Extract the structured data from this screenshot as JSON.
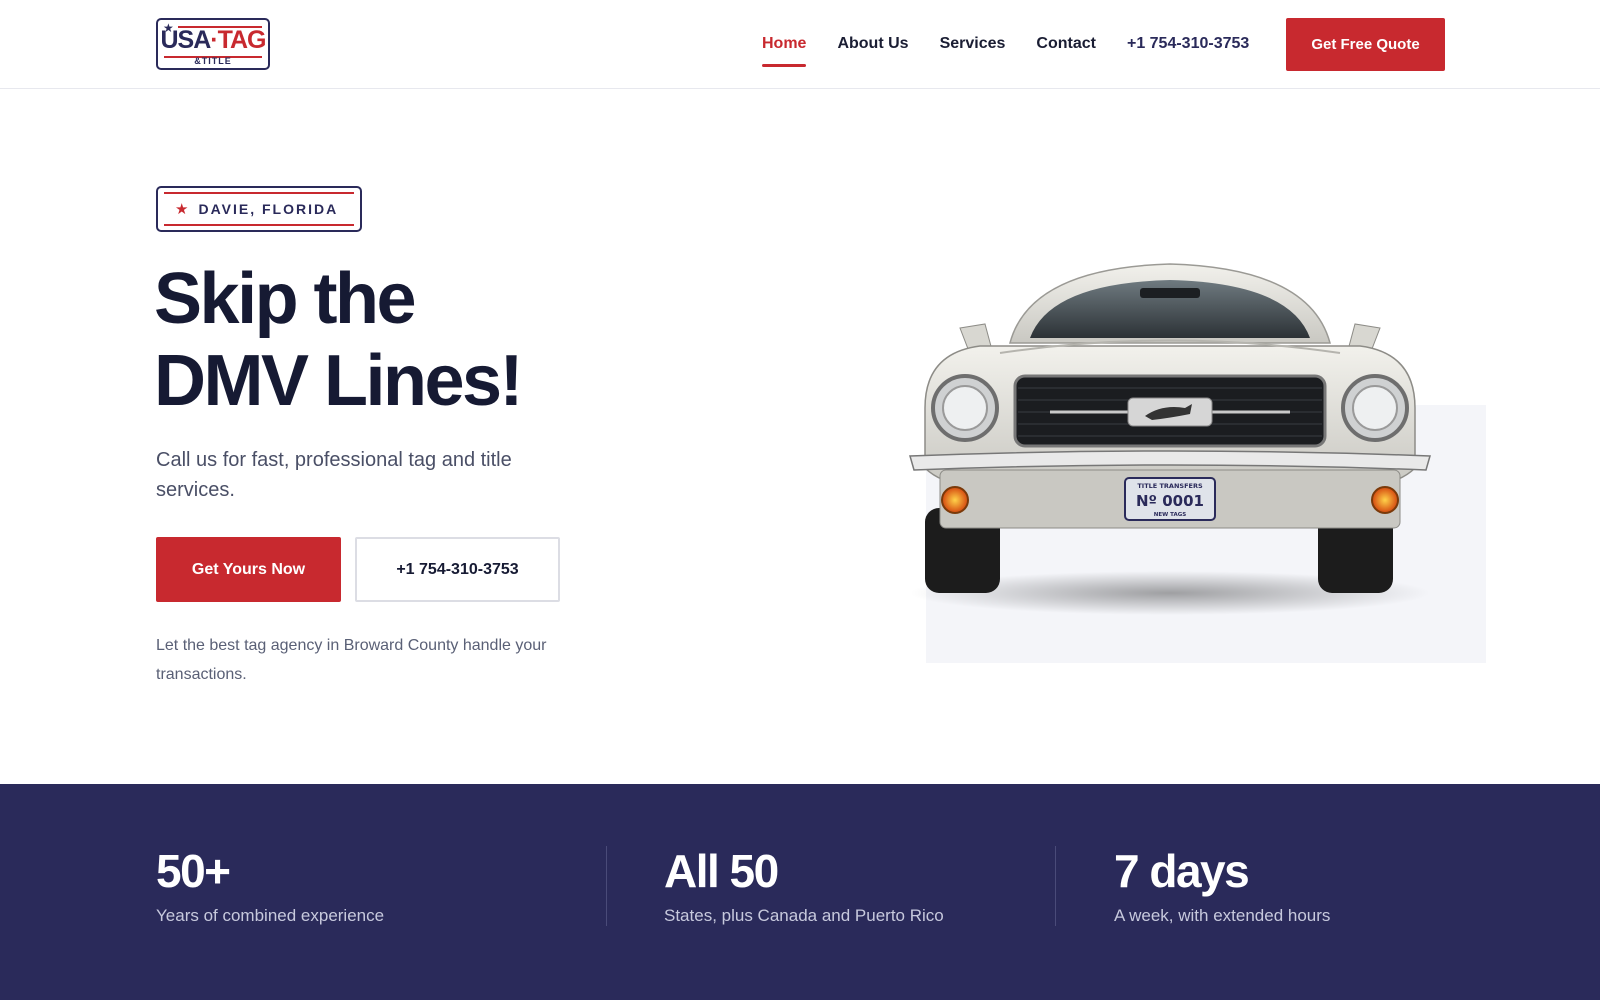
{
  "header": {
    "logo": {
      "line1_a": "USA",
      "line1_b": "·TAG",
      "line2": "&TITLE"
    },
    "nav": [
      {
        "label": "Home",
        "active": true
      },
      {
        "label": "About Us",
        "active": false
      },
      {
        "label": "Services",
        "active": false
      },
      {
        "label": "Contact",
        "active": false
      }
    ],
    "phone": "+1 754-310-3753",
    "cta": "Get Free Quote"
  },
  "hero": {
    "badge": "DAVIE, FLORIDA",
    "badge_icon": "star-icon",
    "title_line1": "Skip the",
    "title_line2": "DMV Lines!",
    "subtitle": "Call us for fast, professional tag and title services.",
    "primary_button": "Get Yours Now",
    "secondary_button": "+1 754-310-3753",
    "note": "Let the best tag agency in Broward County handle your transactions.",
    "plate": {
      "top": "TITLE TRANSFERS",
      "number": "Nº 0001",
      "bottom": "NEW TAGS"
    }
  },
  "stats": [
    {
      "value": "50+",
      "label": "Years of combined experience"
    },
    {
      "value": "All 50",
      "label": "States, plus Canada and Puerto Rico"
    },
    {
      "value": "7 days",
      "label": "A week, with extended hours"
    }
  ],
  "colors": {
    "accent_red": "#c8292f",
    "navy": "#2a2a5a",
    "text_dark": "#161a33"
  }
}
